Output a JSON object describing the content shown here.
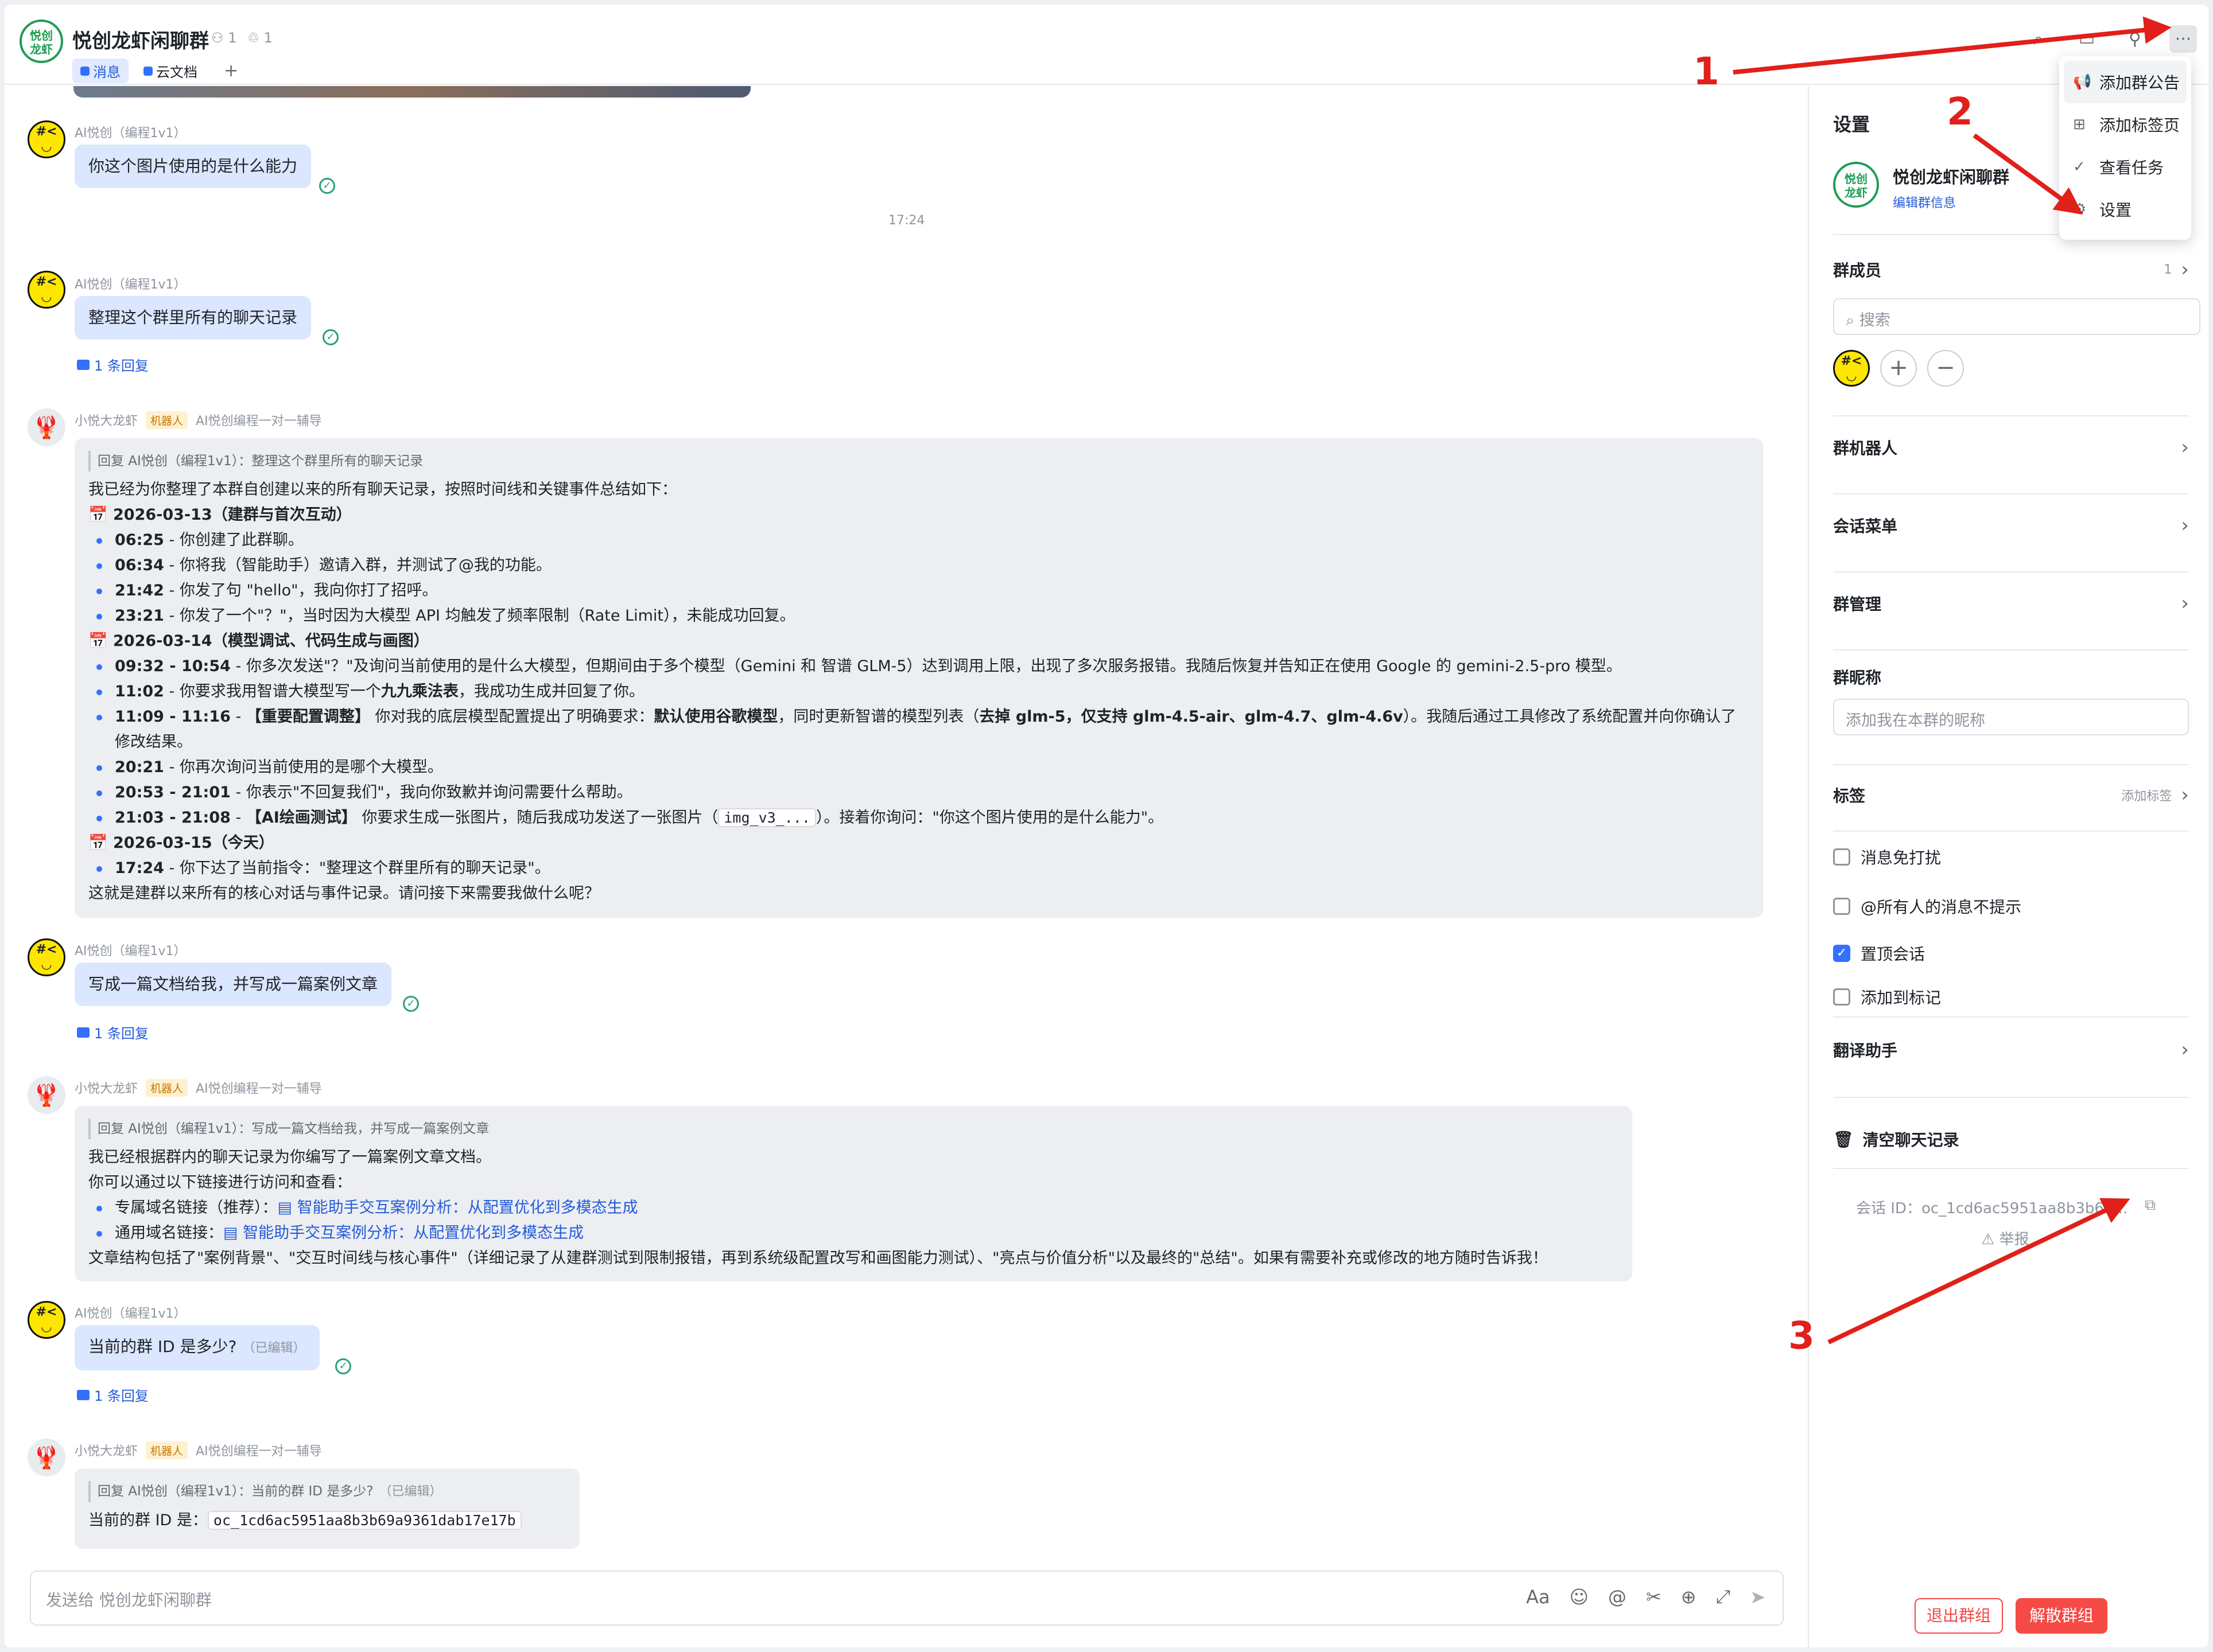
{
  "header": {
    "logo_text": "悦创\n龙虾",
    "group_name": "悦创龙虾闲聊群",
    "member_count": "1",
    "bot_count": "1",
    "tabs": [
      {
        "label": "消息"
      },
      {
        "label": "云文档"
      }
    ],
    "add_tab": "+"
  },
  "messages": {
    "m1": {
      "sender": "AI悦创（编程1v1）",
      "text": "你这个图片使用的是什么能力"
    },
    "time1": "17:24",
    "m2": {
      "sender": "AI悦创（编程1v1）",
      "text": "整理这个群里所有的聊天记录",
      "replies": "1 条回复"
    },
    "b1": {
      "sender": "小悦大龙虾",
      "badge": "机器人",
      "context": "AI悦创编程一对一辅导",
      "quote": "回复 AI悦创（编程1v1）：整理这个群里所有的聊天记录",
      "intro": "我已经为你整理了本群自创建以来的所有聊天记录，按照时间线和关键事件总结如下：",
      "d1": "📅 2026-03-13（建群与首次互动）",
      "d1_items": [
        {
          "b": "06:25",
          "t": " - 你创建了此群聊。"
        },
        {
          "b": "06:34",
          "t": " - 你将我（智能助手）邀请入群，并测试了@我的功能。"
        },
        {
          "b": "21:42",
          "t": " - 你发了句 \"hello\"，我向你打了招呼。"
        },
        {
          "b": "23:21",
          "t": " - 你发了一个\"？\"，当时因为大模型 API 均触发了频率限制（Rate Limit），未能成功回复。"
        }
      ],
      "d2": "📅 2026-03-14（模型调试、代码生成与画图）",
      "d2_i1": {
        "b": "09:32 - 10:54",
        "t": " - 你多次发送\"？\"及询问当前使用的是什么大模型，但期间由于多个模型（Gemini 和 智谱 GLM-5）达到调用上限，出现了多次服务报错。我随后恢复并告知正在使用 Google 的 gemini-2.5-pro 模型。"
      },
      "d2_i2": {
        "b": "11:02",
        "t1": " - 你要求我用智谱大模型写一个",
        "b2": "九九乘法表",
        "t2": "，我成功生成并回复了你。"
      },
      "d2_i3": {
        "b": "11:09 - 11:16",
        "t1": " - ",
        "b2": "【重要配置调整】",
        "t2": " 你对我的底层模型配置提出了明确要求：",
        "b3": "默认使用谷歌模型",
        "t3": "，同时更新智谱的模型列表（",
        "b4": "去掉 glm-5，仅支持 glm-4.5-air、glm-4.7、glm-4.6v",
        "t4": "）。我随后通过工具修改了系统配置并向你确认了修改结果。"
      },
      "d2_i4": {
        "b": "20:21",
        "t": " - 你再次询问当前使用的是哪个大模型。"
      },
      "d2_i5": {
        "b": "20:53 - 21:01",
        "t": " - 你表示\"不回复我们\"，我向你致歉并询问需要什么帮助。"
      },
      "d2_i6": {
        "b": "21:03 - 21:08",
        "t1": " - ",
        "b2": "【AI绘画测试】",
        "t2": " 你要求生成一张图片，随后我成功发送了一张图片（",
        "code": "img_v3_...",
        "t3": "）。接着你询问：\"你这个图片使用的是什么能力\"。"
      },
      "d3": "📅 2026-03-15（今天）",
      "d3_i1": {
        "b": "17:24",
        "t": " - 你下达了当前指令：\"整理这个群里所有的聊天记录\"。"
      },
      "outro": "这就是建群以来所有的核心对话与事件记录。请问接下来需要我做什么呢？"
    },
    "m3": {
      "sender": "AI悦创（编程1v1）",
      "text": "写成一篇文档给我，并写成一篇案例文章",
      "replies": "1 条回复"
    },
    "b2": {
      "sender": "小悦大龙虾",
      "badge": "机器人",
      "context": "AI悦创编程一对一辅导",
      "quote": "回复 AI悦创（编程1v1）：写成一篇文档给我，并写成一篇案例文章",
      "l1": "我已经根据群内的聊天记录为你编写了一篇案例文章文档。",
      "l2": "你可以通过以下链接进行访问和查看：",
      "link1_label": "专属域名链接（推荐）：",
      "link1": "智能助手交互案例分析：从配置优化到多模态生成",
      "link2_label": "通用域名链接：",
      "link2": "智能助手交互案例分析：从配置优化到多模态生成",
      "l3": "文章结构包括了\"案例背景\"、\"交互时间线与核心事件\"（详细记录了从建群测试到限制报错，再到系统级配置改写和画图能力测试）、\"亮点与价值分析\"以及最终的\"总结\"。如果有需要补充或修改的地方随时告诉我！"
    },
    "m4": {
      "sender": "AI悦创（编程1v1）",
      "text": "当前的群 ID 是多少?",
      "edited": "（已编辑）",
      "replies": "1 条回复"
    },
    "b3": {
      "sender": "小悦大龙虾",
      "badge": "机器人",
      "context": "AI悦创编程一对一辅导",
      "quote": "回复 AI悦创（编程1v1）：当前的群 ID 是多少?",
      "quote_edited": "（已编辑）",
      "label": "当前的群 ID 是：",
      "id": "oc_1cd6ac5951aa8b3b69a9361dab17e17b"
    },
    "avatar_smile": "#<\n◡"
  },
  "composer": {
    "placeholder": "发送给 悦创龙虾闲聊群",
    "tools": [
      "Aa",
      "☺",
      "@",
      "✂",
      "⊕",
      "⤢",
      "➤"
    ]
  },
  "menu": {
    "items": [
      {
        "icon": "📢",
        "label": "添加群公告"
      },
      {
        "icon": "⊞",
        "label": "添加标签页"
      },
      {
        "icon": "✓",
        "label": "查看任务"
      },
      {
        "icon": "⚙",
        "label": "设置"
      }
    ]
  },
  "settings": {
    "title": "设置",
    "group_name": "悦创龙虾闲聊群",
    "edit_info": "编辑群信息",
    "members_label": "群成员",
    "members_count": "1",
    "search_placeholder": "搜索",
    "bots": "群机器人",
    "session_menu": "会话菜单",
    "manage": "群管理",
    "nickname_label": "群昵称",
    "nickname_placeholder": "添加我在本群的昵称",
    "tags": "标签",
    "add_tag": "添加标签",
    "opt_mute": "消息免打扰",
    "opt_at_all": "@所有人的消息不提示",
    "opt_pin": "置顶会话",
    "opt_mark": "添加到标记",
    "translate": "翻译助手",
    "clear": "清空聊天记录",
    "session_id": "会话 ID：oc_1cd6ac5951aa8b3b69...",
    "report": "⚠ 举报",
    "quit": "退出群组",
    "dissolve": "解散群组"
  },
  "annotations": {
    "a1": "1",
    "a2": "2",
    "a3": "3"
  },
  "colors": {
    "accent": "#3370ff",
    "danger": "#f54a45",
    "annotation": "#e0201a",
    "success": "#2ea07b"
  }
}
